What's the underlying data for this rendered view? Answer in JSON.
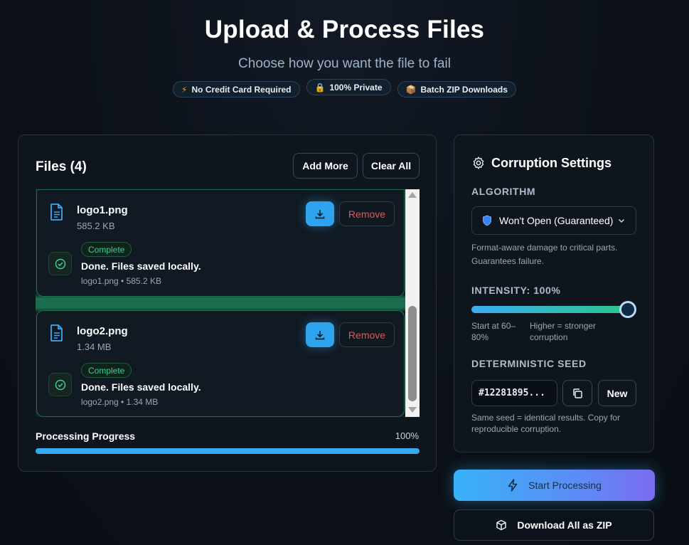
{
  "header": {
    "title": "Upload & Process Files",
    "subtitle": "Choose how you want the file to fail",
    "badges": [
      {
        "icon": "lightning-icon",
        "label": "No Credit Card Required"
      },
      {
        "icon": "lock-icon",
        "label": "100% Private"
      },
      {
        "icon": "package-icon",
        "label": "Batch ZIP Downloads"
      }
    ]
  },
  "files": {
    "title": "Files (4)",
    "add_more": "Add More",
    "clear_all": "Clear All",
    "items": [
      {
        "name": "logo1.png",
        "size": "585.2 KB",
        "remove": "Remove",
        "status": "Complete",
        "message": "Done. Files saved locally.",
        "meta": "logo1.png • 585.2 KB"
      },
      {
        "name": "logo2.png",
        "size": "1.34 MB",
        "remove": "Remove",
        "status": "Complete",
        "message": "Done. Files saved locally.",
        "meta": "logo2.png • 1.34 MB"
      }
    ],
    "progress_label": "Processing Progress",
    "progress_text": "100%",
    "progress_value": 1.0
  },
  "settings": {
    "title": "Corruption Settings",
    "algorithm_label": "ALGORITHM",
    "algorithm_value": "Won't Open (Guaranteed)",
    "algorithm_help": "Format-aware damage to critical parts. Guarantees failure.",
    "intensity_label": "INTENSITY: 100%",
    "intensity_value": 1.0,
    "intensity_note_left": "Start at 60–80%",
    "intensity_note_right": "Higher = stronger corruption",
    "seed_label": "DETERMINISTIC SEED",
    "seed_value": "#12281895...",
    "seed_new": "New",
    "seed_help": "Same seed = identical results. Copy for reproducible corruption."
  },
  "actions": {
    "start": "Start Processing",
    "zip": "Download All as ZIP"
  },
  "colors": {
    "accent_blue": "#35a9f2",
    "success_green": "#34d399",
    "danger_red": "#ef4f4f",
    "background": "#0c1118"
  }
}
